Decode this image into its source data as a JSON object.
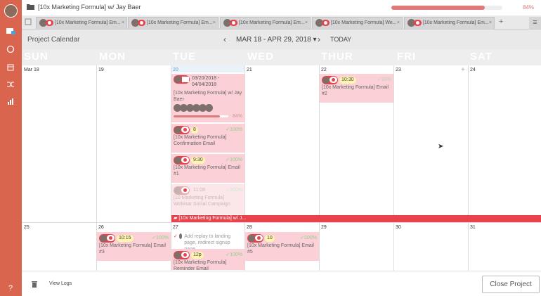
{
  "window": {
    "project_title": "[10x Marketing Formula] w/ Jay Baer",
    "progress_text": "84%",
    "progress_value": 0.84
  },
  "tabs": [
    {
      "label": "[10x Marketing Formula] Em..."
    },
    {
      "label": "[10x Marketing Formula] Em..."
    },
    {
      "label": "[10x Marketing Formula] Em..."
    },
    {
      "label": "[10x Marketing Formula] We..."
    },
    {
      "label": "[10x Marketing Formula] Em..."
    }
  ],
  "tab_add_label": "+",
  "tab_menu_label": "≡",
  "header": {
    "title": "Project Calendar",
    "date_range": "MAR 18 - APR 29, 2018",
    "today": "TODAY"
  },
  "day_names": [
    "SUN",
    "MON",
    "TUE",
    "WED",
    "THUR",
    "FRI",
    "SAT"
  ],
  "week1": [
    "Mar 18",
    "19",
    "20",
    "21",
    "22",
    "23",
    "24"
  ],
  "week2": [
    "25",
    "26",
    "27",
    "28",
    "29",
    "30",
    "31"
  ],
  "events": {
    "project": {
      "dates": "03/20/2018 - 04/04/2018",
      "title": "[10x Marketing Formula] w/ Jay Baer",
      "pct": "84%"
    },
    "tue1": {
      "tag": "8",
      "pct": "✓100%",
      "title": "[10x Marketing Formula] Confirmation Email"
    },
    "tue2": {
      "tag": "9:30",
      "pct": "✓100%",
      "title": "[10x Marketing Formula] Email #1"
    },
    "tue3": {
      "tag": "11:08",
      "pct": "✓100%",
      "title": "[10 Marketing Formula] Webinar Social Campaign"
    },
    "thu1": {
      "tag": "10:30",
      "pct": "✓33%",
      "title": "[10x Marketing Formula] Email #2"
    },
    "mon2": {
      "tag": "10:15",
      "pct": "✓100%",
      "title": "[10x Marketing Formula] Email #3"
    },
    "tue4": {
      "title": "Add replay to landing page, redirect signup page"
    },
    "tue5": {
      "tag": "12p",
      "pct": "✓100%",
      "title": "[10x Marketing Formula] Reminder Email"
    },
    "wed2": {
      "tag": "10",
      "pct": "✓100%",
      "title": "[10x Marketing Formula] Email #5"
    }
  },
  "banner": "[10x Marketing Formula] w/ J...",
  "footer": {
    "view_logs": "View Logs",
    "close_project": "Close Project"
  },
  "sidebar": {
    "help": "?"
  }
}
